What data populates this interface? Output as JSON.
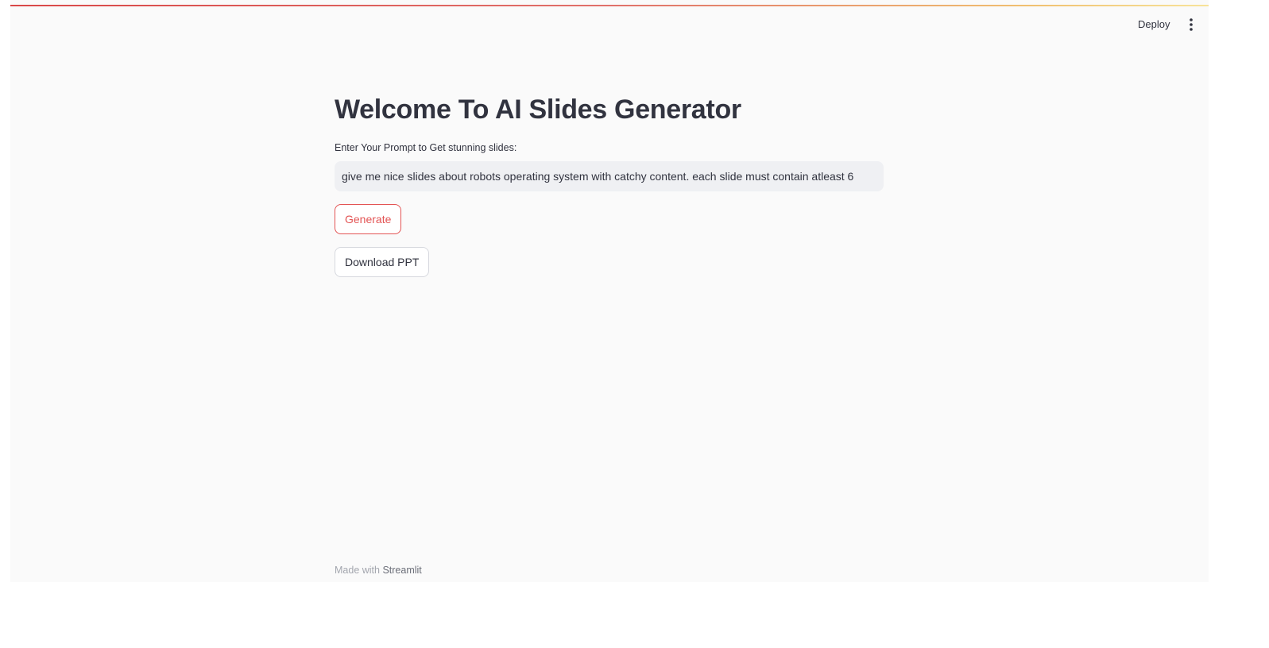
{
  "header": {
    "deploy_label": "Deploy",
    "menu_icon": "vertical-ellipsis-icon",
    "decoration_colors": [
      "#d94848",
      "#e0706a",
      "#f0c070",
      "#f7e39a"
    ]
  },
  "main": {
    "title": "Welcome To AI Slides Generator",
    "prompt": {
      "label": "Enter Your Prompt to Get stunning slides:",
      "value": "give me nice slides about robots operating system with catchy content. each slide must contain atleast 6",
      "placeholder": ""
    },
    "generate_label": "Generate",
    "download_label": "Download PPT"
  },
  "footer": {
    "prefix": "Made with ",
    "link": "Streamlit"
  },
  "colors": {
    "accent": "#e35454",
    "text": "#31333f",
    "background": "#fafafa",
    "input_background": "#eff0f3"
  }
}
